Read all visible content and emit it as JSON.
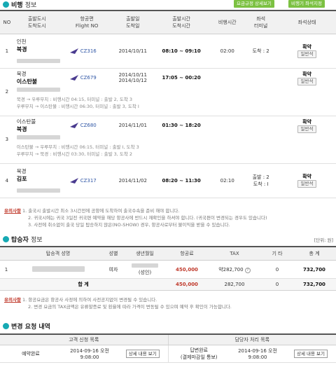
{
  "flight_section": {
    "title": "비행",
    "title_light": "정보",
    "btn_fare_rules": "요금규정 상세보기",
    "btn_seat": "비행기 좌석지정"
  },
  "flight_headers": {
    "no": "NO",
    "depart_city": "출발도시",
    "arrive_city": "도착도시",
    "flight": "항공편",
    "flight_en": "Flight NO",
    "depart_date": "출발일",
    "arrive_date": "도착일",
    "depart_time": "출발시간",
    "arrive_time": "도착시간",
    "duration": "비행시간",
    "seat": "좌석",
    "terminal": "터미널",
    "seat_status": "좌석상태"
  },
  "flights": [
    {
      "no": "1",
      "from": "인천",
      "to": "북경",
      "flight": "CZ316",
      "dep_date": "2014/10/11",
      "arr_date": "",
      "time": "08:10 ~ 09:10",
      "duration": "02:00",
      "terminal": "도착 : 2",
      "status": "확약",
      "seat": "일반석",
      "via": []
    },
    {
      "no": "2",
      "from": "북경",
      "to": "이스탄불",
      "flight": "CZ679",
      "dep_date": "2014/10/11",
      "arr_date": "2014/10/12",
      "time": "17:05 ~ 00:20",
      "duration": "",
      "terminal": "",
      "status": "확약",
      "seat": "일반석",
      "via": [
        "북경 → 우루무치 : 비행시간 04:15, 터미널 : 출발 2, 도착 3",
        "우루무치 → 이스탄불 : 비행시간 06:30, 터미널 : 출발 3, 도착 I"
      ]
    },
    {
      "no": "3",
      "from": "이스탄불",
      "to": "북경",
      "flight": "CZ680",
      "dep_date": "2014/11/01",
      "arr_date": "",
      "time": "01:30 ~ 18:20",
      "duration": "",
      "terminal": "",
      "status": "확약",
      "seat": "일반석",
      "via": [
        "이스탄불 → 우루무치 : 비행시간 06:15, 터미널 : 출발 I, 도착 3",
        "우루무치 → 북경 : 비행시간 03:30, 터미널 : 출발 3, 도착 2"
      ]
    },
    {
      "no": "4",
      "from": "북경",
      "to": "김포",
      "flight": "CZ317",
      "dep_date": "2014/11/02",
      "arr_date": "",
      "time": "08:20 ~ 11:30",
      "duration": "02:10",
      "terminal": "출발 : 2",
      "terminal2": "도착 : I",
      "status": "확약",
      "seat": "일반석",
      "via": []
    }
  ],
  "notice1": {
    "label": "유의사항",
    "lines": [
      "1. 출국시 출발시간 최소 3시간전에 공항에 도착하여 출국수속을 준비 해야 합니다.",
      "2. 귀국시에는 귀국 3일전 귀국편 예약을 해당 항공사에 반드시 재확인을 하셔야 합니다. (귀국편이 변경되는 경우도 있습니다)",
      "3. 사전에 취소없이 출국 당일 탑승하지 않은(NO-SHOW) 경우, 항공사로부터 불이익을 받을 수 있습니다."
    ]
  },
  "passenger_section": {
    "title": "탑승자",
    "title_light": "정보",
    "unit": "[단위: 원]"
  },
  "passenger_headers": {
    "name": "탑승객 성명",
    "gender": "성별",
    "birth": "생년월일",
    "fare": "항공료",
    "tax": "TAX",
    "etc": "기 타",
    "total": "총 계"
  },
  "passengers": [
    {
      "no": "1",
      "gender": "여자",
      "birth": "(성인)",
      "fare": "450,000",
      "tax": "약282,700",
      "etc": "0",
      "total": "732,700"
    }
  ],
  "totals": {
    "label": "합 계",
    "fare": "450,000",
    "tax": "282,700",
    "etc": "0",
    "total": "732,700"
  },
  "notice2": {
    "label": "유의사항",
    "lines": [
      "1. 항공요금은 항공사 사정에 의하여 사전공지없이 변경될 수 있습니다.",
      "2. 변경 요금의 TAX금액은 유류할증료 및 환율에 따라 가격이 변동될 수 있으며 예약 후 확인이 가능합니다."
    ]
  },
  "change_section": {
    "title": "변경 요청 내역"
  },
  "change_headers": {
    "customer": "고객 신청 목록",
    "staff": "담당자 처리 목록"
  },
  "change_rows": [
    {
      "c_status": "예약완료",
      "c_date": "2014-09-16 오전",
      "c_time": "9:08:00",
      "c_btn": "상세 내용 보기",
      "s_status": "답변완료",
      "s_status2": "(결제마감일 통보)",
      "s_date": "2014-09-16 오전",
      "s_time": "9:08:00",
      "s_btn": "상세 내용 보기"
    }
  ],
  "colors": {
    "accent": "#16a9b3",
    "green": "#7cc142",
    "red": "#c0392b",
    "blue": "#3057a6"
  }
}
